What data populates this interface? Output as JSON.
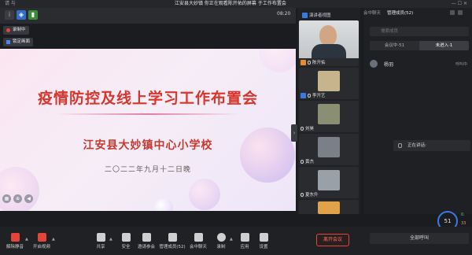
{
  "titlebar": {
    "left": "请 与",
    "title": "江安县大妙镇   你正在观看陈开佑的屏幕   于工作布置会",
    "right": "— ☐ ✕"
  },
  "time": "08:20",
  "pills": {
    "recording": "录制中",
    "lock": "锁定画面"
  },
  "slide": {
    "title": "疫情防控及线上学习工作布置会",
    "subtitle": "江安县大妙镇中心小学校",
    "date": "二〇二二年九月十二日晚"
  },
  "gallery": {
    "header": "演讲者视图",
    "items": [
      {
        "name": "陈开佑",
        "thumb_color": "#cfd3d6"
      },
      {
        "name": "李开艺",
        "thumb_color": "#c8b48c"
      },
      {
        "name": "刘昊",
        "thumb_color": "#8a8f74"
      },
      {
        "name": "黄杰",
        "thumb_color": "#7a7f88"
      },
      {
        "name": "夏东升",
        "thumb_color": "#9aa0a8"
      },
      {
        "name": "",
        "thumb_color": "#e0a34a"
      }
    ]
  },
  "panel": {
    "tabs": [
      "会中聊天",
      "管理成员(52)"
    ],
    "search_placeholder": "搜索成员",
    "segments": [
      "会议中·51",
      "未进入·1"
    ],
    "member": {
      "name": "杨羽",
      "status": "呼叫中"
    },
    "speaking": "正在讲话:",
    "net": {
      "score": "51",
      "up": "0.",
      "down": "33"
    },
    "all_call": "全部呼叫"
  },
  "toolbar": {
    "tools": [
      {
        "id": "unmute",
        "label": "解除静音",
        "red": true
      },
      {
        "id": "video",
        "label": "开启视频",
        "red": true
      },
      {
        "id": "share",
        "label": "共享",
        "red": false
      },
      {
        "id": "security",
        "label": "安全",
        "red": false
      },
      {
        "id": "invite",
        "label": "邀请参会",
        "red": false
      },
      {
        "id": "members",
        "label": "管理成员(52)",
        "red": false
      },
      {
        "id": "chat",
        "label": "会中聊天",
        "red": false
      },
      {
        "id": "record",
        "label": "录制",
        "red": false
      },
      {
        "id": "apps",
        "label": "应用",
        "red": false
      },
      {
        "id": "settings",
        "label": "设置",
        "red": false
      }
    ],
    "leave": "离开会议"
  }
}
